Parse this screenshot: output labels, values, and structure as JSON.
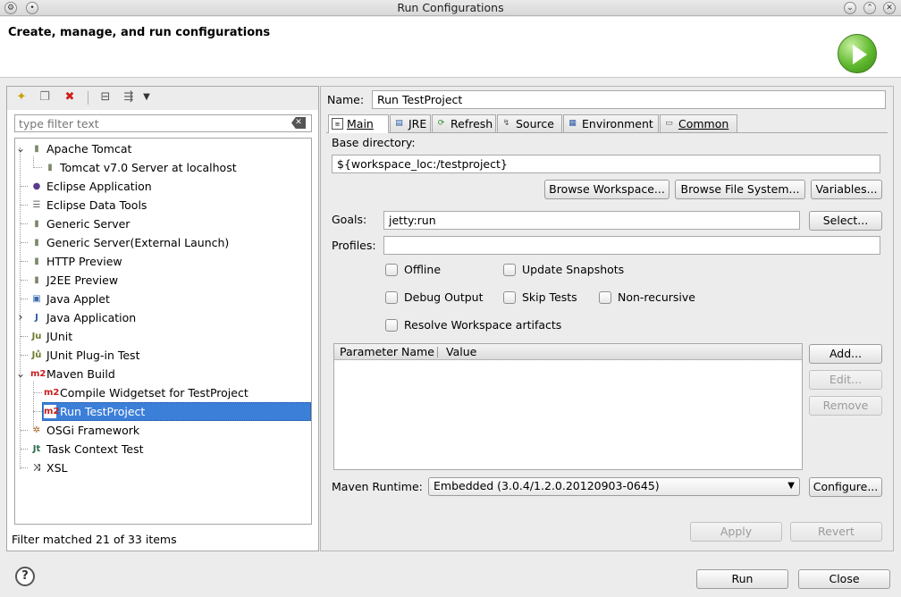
{
  "window": {
    "title": "Run Configurations"
  },
  "banner": {
    "title": "Create, manage, and run configurations"
  },
  "left": {
    "filter_placeholder": "type filter text",
    "status": "Filter matched 21 of 33 items",
    "tree": [
      {
        "label": "Apache Tomcat",
        "icon": "server-icon",
        "level": 0,
        "expanded": true
      },
      {
        "label": "Tomcat v7.0 Server at localhost",
        "icon": "server-icon",
        "level": 1
      },
      {
        "label": "Eclipse Application",
        "icon": "eclipse-icon",
        "level": 0
      },
      {
        "label": "Eclipse Data Tools",
        "icon": "database-icon",
        "level": 0
      },
      {
        "label": "Generic Server",
        "icon": "server-icon",
        "level": 0
      },
      {
        "label": "Generic Server(External Launch)",
        "icon": "server-icon",
        "level": 0
      },
      {
        "label": "HTTP Preview",
        "icon": "server-icon",
        "level": 0
      },
      {
        "label": "J2EE Preview",
        "icon": "server-icon",
        "level": 0
      },
      {
        "label": "Java Applet",
        "icon": "applet-icon",
        "level": 0
      },
      {
        "label": "Java Application",
        "icon": "java-app-icon",
        "level": 0,
        "collapsed": true
      },
      {
        "label": "JUnit",
        "icon": "junit-icon",
        "level": 0
      },
      {
        "label": "JUnit Plug-in Test",
        "icon": "junit-plugin-icon",
        "level": 0
      },
      {
        "label": "Maven Build",
        "icon": "maven-icon",
        "level": 0,
        "expanded": true
      },
      {
        "label": "Compile Widgetset for TestProject",
        "icon": "maven-icon",
        "level": 1
      },
      {
        "label": "Run TestProject",
        "icon": "maven-icon",
        "level": 1,
        "selected": true
      },
      {
        "label": "OSGi Framework",
        "icon": "osgi-icon",
        "level": 0
      },
      {
        "label": "Task Context Test",
        "icon": "task-icon",
        "level": 0
      },
      {
        "label": "XSL",
        "icon": "xsl-icon",
        "level": 0
      }
    ]
  },
  "right": {
    "name_label": "Name:",
    "name_value": "Run TestProject",
    "tabs": [
      {
        "label": "Main",
        "icon": "main-tab-icon"
      },
      {
        "label": "JRE",
        "icon": "jre-tab-icon"
      },
      {
        "label": "Refresh",
        "icon": "refresh-tab-icon"
      },
      {
        "label": "Source",
        "icon": "source-tab-icon"
      },
      {
        "label": "Environment",
        "icon": "environment-tab-icon"
      },
      {
        "label": "Common",
        "icon": "common-tab-icon"
      }
    ],
    "base_dir_label": "Base directory:",
    "base_dir_value": "${workspace_loc:/testproject}",
    "browse_workspace": "Browse Workspace...",
    "browse_fs": "Browse File System...",
    "variables": "Variables...",
    "goals_label": "Goals:",
    "goals_value": "jetty:run",
    "select": "Select...",
    "profiles_label": "Profiles:",
    "profiles_value": "",
    "checks": {
      "offline": "Offline",
      "update_snapshots": "Update Snapshots",
      "debug_output": "Debug Output",
      "skip_tests": "Skip Tests",
      "non_recursive": "Non-recursive",
      "resolve_workspace": "Resolve Workspace artifacts"
    },
    "params": {
      "col_name": "Parameter Name",
      "col_value": "Value"
    },
    "add": "Add...",
    "edit": "Edit...",
    "remove": "Remove",
    "runtime_label": "Maven Runtime:",
    "runtime_value": "Embedded (3.0.4/1.2.0.20120903-0645)",
    "configure": "Configure...",
    "apply": "Apply",
    "revert": "Revert"
  },
  "footer": {
    "run": "Run",
    "close": "Close"
  }
}
